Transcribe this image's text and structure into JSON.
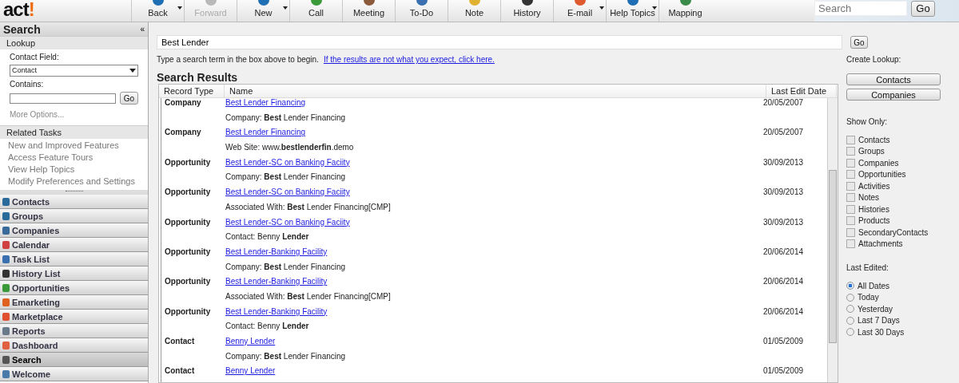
{
  "logo": {
    "text": "act",
    "accent": "!"
  },
  "toolbar": [
    {
      "label": "Back",
      "disabled": false,
      "dropdown": true
    },
    {
      "label": "Forward",
      "disabled": true,
      "dropdown": false
    },
    {
      "label": "New",
      "disabled": false,
      "dropdown": true
    },
    {
      "label": "Call",
      "disabled": false,
      "dropdown": false
    },
    {
      "label": "Meeting",
      "disabled": false,
      "dropdown": false
    },
    {
      "label": "To-Do",
      "disabled": false,
      "dropdown": false
    },
    {
      "label": "Note",
      "disabled": false,
      "dropdown": false
    },
    {
      "label": "History",
      "disabled": false,
      "dropdown": false
    },
    {
      "label": "E-mail",
      "disabled": false,
      "dropdown": true
    },
    {
      "label": "Help Topics",
      "disabled": false,
      "dropdown": true
    },
    {
      "label": "Mapping",
      "disabled": false,
      "dropdown": false
    }
  ],
  "top_search": {
    "placeholder": "Search",
    "button": "Go"
  },
  "sidebar": {
    "title": "Search",
    "collapse": "«",
    "lookup": {
      "header": "Lookup",
      "field_label": "Contact Field:",
      "field_value": "Contact",
      "contains_label": "Contains:",
      "button": "Go",
      "more": "More Options..."
    },
    "related": {
      "header": "Related Tasks",
      "items": [
        "New and Improved Features",
        "Access Feature Tours",
        "View Help Topics",
        "Modify Preferences and Settings"
      ]
    },
    "nav": [
      {
        "label": "Contacts",
        "selected": false
      },
      {
        "label": "Groups",
        "selected": false
      },
      {
        "label": "Companies",
        "selected": false
      },
      {
        "label": "Calendar",
        "selected": false
      },
      {
        "label": "Task List",
        "selected": false
      },
      {
        "label": "History List",
        "selected": false
      },
      {
        "label": "Opportunities",
        "selected": false
      },
      {
        "label": "Emarketing",
        "selected": false
      },
      {
        "label": "Marketplace",
        "selected": false
      },
      {
        "label": "Reports",
        "selected": false
      },
      {
        "label": "Dashboard",
        "selected": false
      },
      {
        "label": "Search",
        "selected": true
      },
      {
        "label": "Welcome",
        "selected": false
      }
    ]
  },
  "search": {
    "value": "Best Lender",
    "button": "Go",
    "hint": "Type a search term in the box above to begin.",
    "link": "If the results are not what you expect, click here."
  },
  "results": {
    "title": "Search Results",
    "columns": [
      "Record Type",
      "Name",
      "Last Edit Date"
    ],
    "rows": [
      {
        "type": "Company",
        "name": "Best Lender Financing",
        "date": "20/05/2007",
        "detail": "Company: **Best** Lender Financing"
      },
      {
        "type": "Company",
        "name": "Best Lender Financing",
        "date": "20/05/2007",
        "detail": "Web Site: www.**bestlenderfin**.demo"
      },
      {
        "type": "Opportunity",
        "name": "Best Lender-SC on Banking Faciity",
        "date": "30/09/2013",
        "detail": "Company: **Best** Lender Financing"
      },
      {
        "type": "Opportunity",
        "name": "Best Lender-SC on Banking Faciity",
        "date": "30/09/2013",
        "detail": "Associated With: **Best** Lender Financing[CMP]"
      },
      {
        "type": "Opportunity",
        "name": "Best Lender-SC on Banking Faciity",
        "date": "30/09/2013",
        "detail": "Contact: Benny **Lender**"
      },
      {
        "type": "Opportunity",
        "name": "Best Lender-Banking Facility",
        "date": "20/06/2014",
        "detail": "Company: **Best** Lender Financing"
      },
      {
        "type": "Opportunity",
        "name": "Best Lender-Banking Facility",
        "date": "20/06/2014",
        "detail": "Associated With: **Best** Lender Financing[CMP]"
      },
      {
        "type": "Opportunity",
        "name": "Best Lender-Banking Facility",
        "date": "20/06/2014",
        "detail": "Contact: Benny **Lender**"
      },
      {
        "type": "Contact",
        "name": "Benny Lender",
        "date": "01/05/2009",
        "detail": "Company: **Best** Lender Financing"
      },
      {
        "type": "Contact",
        "name": "Benny Lender",
        "date": "01/05/2009"
      }
    ]
  },
  "right": {
    "create_label": "Create Lookup:",
    "create_buttons": [
      "Contacts",
      "Companies"
    ],
    "show_label": "Show Only:",
    "show": [
      {
        "label": "Contacts",
        "checked": false
      },
      {
        "label": "Groups",
        "checked": false
      },
      {
        "label": "Companies",
        "checked": false
      },
      {
        "label": "Opportunities",
        "checked": false
      },
      {
        "label": "Activities",
        "checked": false
      },
      {
        "label": "Notes",
        "checked": false
      },
      {
        "label": "Histories",
        "checked": false
      },
      {
        "label": "Products",
        "checked": false
      },
      {
        "label": "SecondaryContacts",
        "checked": false
      },
      {
        "label": "Attachments",
        "checked": false
      }
    ],
    "edited_label": "Last Edited:",
    "edited": [
      {
        "label": "All Dates",
        "selected": true
      },
      {
        "label": "Today",
        "selected": false
      },
      {
        "label": "Yesterday",
        "selected": false
      },
      {
        "label": "Last 7 Days",
        "selected": false
      },
      {
        "label": "Last 30 Days",
        "selected": false
      }
    ]
  }
}
